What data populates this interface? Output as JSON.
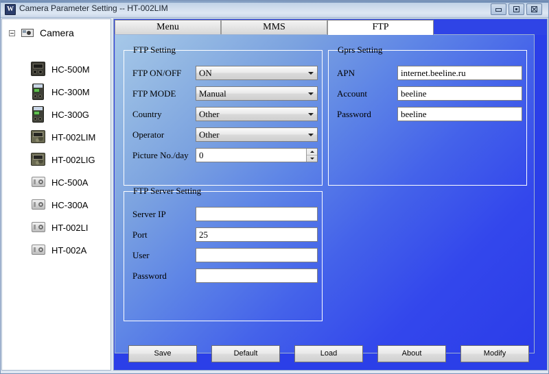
{
  "window": {
    "title": "Camera Parameter Setting -- HT-002LIM",
    "app_icon": "W",
    "controls": {
      "minimize": "minimize-icon",
      "maximize": "maximize-icon",
      "close": "close-icon"
    }
  },
  "sidebar": {
    "root_label": "Camera",
    "items": [
      {
        "label": "HC-500M",
        "icon": "camera-dark-icon"
      },
      {
        "label": "HC-300M",
        "icon": "camera-green-icon"
      },
      {
        "label": "HC-300G",
        "icon": "camera-green-icon"
      },
      {
        "label": "HT-002LIM",
        "icon": "camera-camo-icon"
      },
      {
        "label": "HT-002LIG",
        "icon": "camera-camo-icon"
      },
      {
        "label": "HC-500A",
        "icon": "camera-grey-icon"
      },
      {
        "label": "HC-300A",
        "icon": "camera-grey-icon"
      },
      {
        "label": "HT-002LI",
        "icon": "camera-grey-icon"
      },
      {
        "label": "HT-002A",
        "icon": "camera-grey-icon"
      }
    ]
  },
  "tabs": [
    {
      "label": "Menu",
      "active": false
    },
    {
      "label": "MMS",
      "active": false
    },
    {
      "label": "FTP",
      "active": true
    }
  ],
  "ftp_setting": {
    "title": "FTP Setting",
    "fields": {
      "ftp_on_off": {
        "label": "FTP ON/OFF",
        "value": "ON"
      },
      "ftp_mode": {
        "label": "FTP MODE",
        "value": "Manual"
      },
      "country": {
        "label": "Country",
        "value": "Other"
      },
      "operator": {
        "label": "Operator",
        "value": "Other"
      },
      "picture_no_day": {
        "label": "Picture No./day",
        "value": "0"
      }
    }
  },
  "gprs_setting": {
    "title": "Gprs Setting",
    "fields": {
      "apn": {
        "label": "APN",
        "value": "internet.beeline.ru"
      },
      "account": {
        "label": "Account",
        "value": "beeline"
      },
      "password": {
        "label": "Password",
        "value": "beeline"
      }
    }
  },
  "ftp_server_setting": {
    "title": "FTP Server Setting",
    "fields": {
      "server_ip": {
        "label": "Server IP",
        "value": ""
      },
      "port": {
        "label": "Port",
        "value": "25"
      },
      "user": {
        "label": "User",
        "value": ""
      },
      "password": {
        "label": "Password",
        "value": ""
      }
    }
  },
  "buttons": {
    "save": "Save",
    "default": "Default",
    "load": "Load",
    "about": "About",
    "modify": "Modify"
  },
  "colors": {
    "pane_blue_light": "#a6c8e8",
    "pane_blue_dark": "#2b3ce9",
    "titlebar": "#cfdcec",
    "active_tab": "#ffffff"
  }
}
